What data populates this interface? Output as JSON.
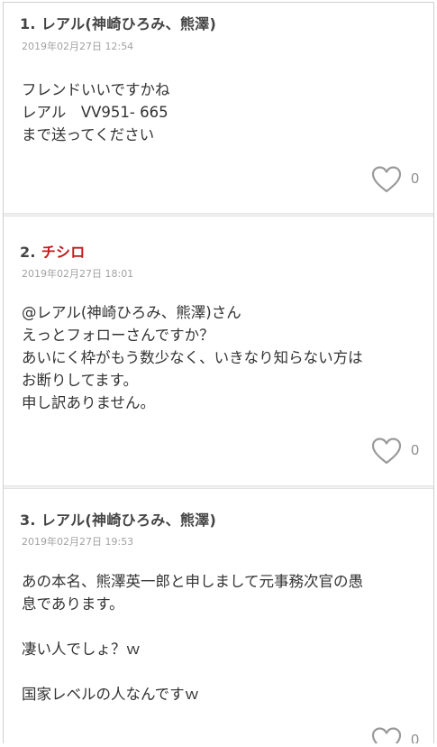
{
  "comments": [
    {
      "number": "1.",
      "author": "レアル(神崎ひろみ、熊澤)",
      "date": "2019年02月27日 12:54",
      "lines": [
        "フレンドいいですかね",
        "レアル　VV951- 665",
        "まで送ってください"
      ],
      "likes": "0"
    },
    {
      "number": "2.",
      "author": "チシロ",
      "date": "2019年02月27日 18:01",
      "lines": [
        "@レアル(神崎ひろみ、熊澤)さん",
        "えっとフォローさんですか？",
        "あいにく枠がもう数少なく、いきなり知らない方は",
        "お断りしてます。",
        "申し訳ありません。"
      ],
      "likes": "0"
    },
    {
      "number": "3.",
      "author": "レアル(神崎ひろみ、熊澤)",
      "date": "2019年02月27日 19:53",
      "lines": [
        "あの本名、熊澤英一郎と申しまして元事務次官の愚",
        "息であります。",
        "",
        "凄い人でしょ？ｗ",
        "",
        "国家レベルの人なんですｗ"
      ],
      "likes": "0"
    }
  ],
  "icons": {
    "like": "heart-outline-icon"
  },
  "colors": {
    "author_highlight": "#c21a1a",
    "date_gray": "#a2a2a2",
    "icon_gray": "#9a9a9a"
  }
}
